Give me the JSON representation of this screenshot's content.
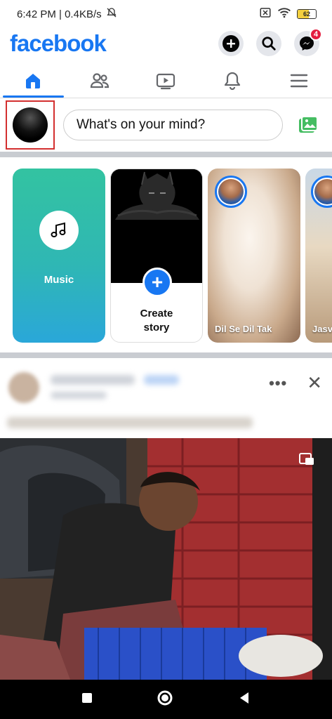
{
  "status_bar": {
    "time_speed": "6:42 PM | 0.4KB/s",
    "battery_level": "62",
    "battery_fraction": 0.62
  },
  "header": {
    "logo": "facebook",
    "messenger_badge": "4"
  },
  "tabs": [
    {
      "name": "home",
      "icon": "home-icon",
      "active": true
    },
    {
      "name": "friends",
      "icon": "friends-icon",
      "active": false
    },
    {
      "name": "watch",
      "icon": "video-icon",
      "active": false
    },
    {
      "name": "notifications",
      "icon": "bell-icon",
      "active": false
    },
    {
      "name": "menu",
      "icon": "hamburger-icon",
      "active": false
    }
  ],
  "composer": {
    "placeholder": "What's on your mind?"
  },
  "stories": [
    {
      "type": "music",
      "label": "Music"
    },
    {
      "type": "create",
      "label_line1": "Create",
      "label_line2": "story"
    },
    {
      "type": "friend",
      "name": "Dil Se Dil Tak"
    },
    {
      "type": "friend",
      "name": "Jasv"
    }
  ],
  "colors": {
    "brand": "#1877f2",
    "badge": "#e41e3f",
    "highlight": "#d32f2f"
  }
}
